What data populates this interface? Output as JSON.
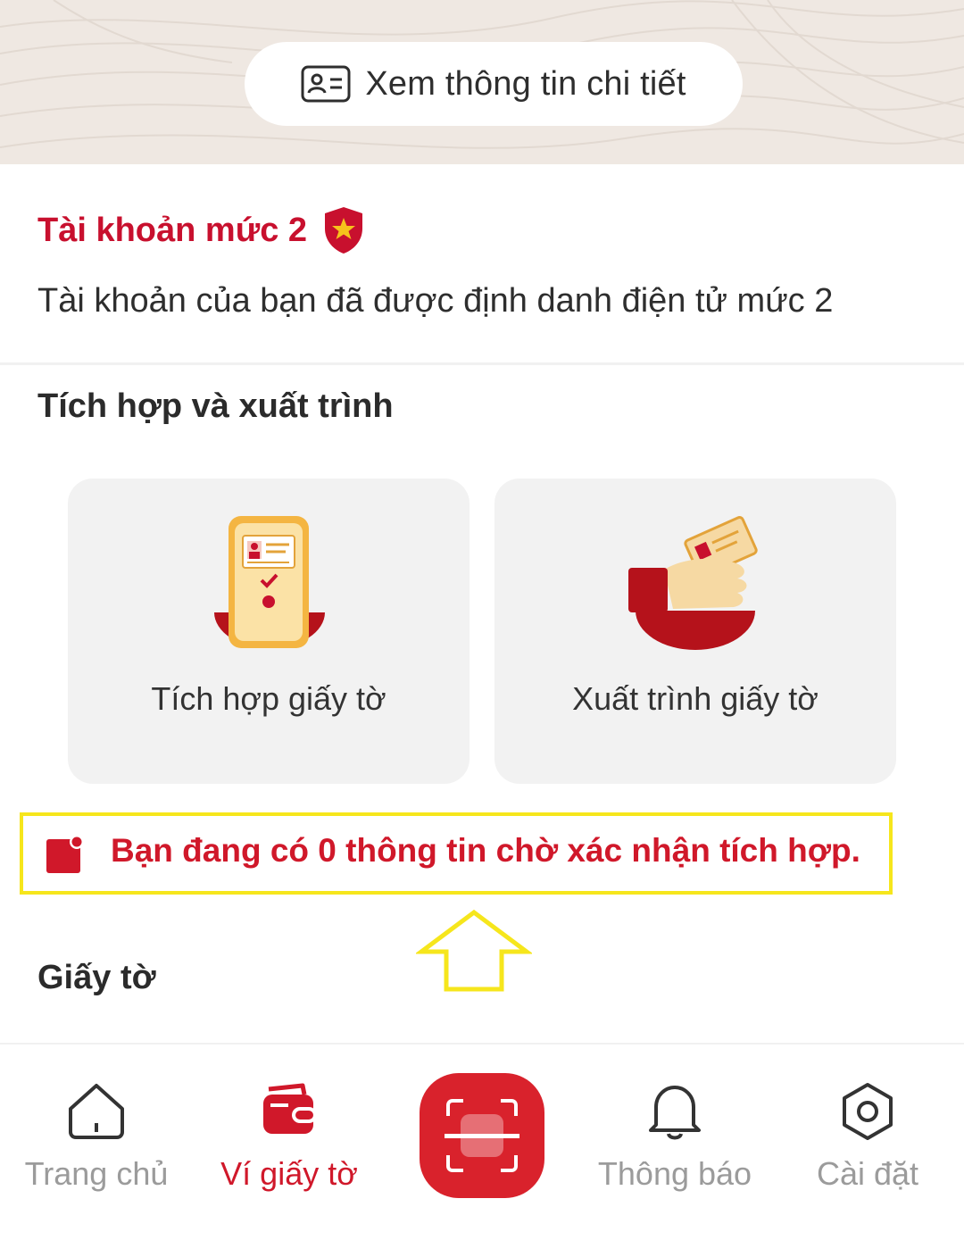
{
  "header": {
    "detail_button_label": "Xem thông tin chi tiết",
    "detail_icon": "id-card-icon"
  },
  "account": {
    "title": "Tài khoản mức 2",
    "badge_icon": "shield-star-icon",
    "description": "Tài khoản của bạn đã được định danh điện tử mức 2"
  },
  "integration": {
    "section_title": "Tích hợp và xuất trình",
    "cards": [
      {
        "label": "Tích hợp giấy tờ",
        "icon": "phone-document-icon"
      },
      {
        "label": "Xuất trình giấy tờ",
        "icon": "hand-card-icon"
      }
    ]
  },
  "notice": {
    "icon": "notification-square-icon",
    "text": "Bạn đang có 0 thông tin chờ xác nhận tích hợp."
  },
  "documents": {
    "section_title": "Giấy tờ"
  },
  "bottom_nav": {
    "items": [
      {
        "label": "Trang chủ",
        "icon": "home-icon",
        "active": false
      },
      {
        "label": "Ví giấy tờ",
        "icon": "wallet-icon",
        "active": true
      },
      {
        "label": "Thông báo",
        "icon": "bell-icon",
        "active": false
      },
      {
        "label": "Cài đặt",
        "icon": "settings-icon",
        "active": false
      }
    ],
    "scan_icon": "scan-icon"
  },
  "colors": {
    "brand_red": "#d0182a",
    "annotation_yellow": "#f6e61c",
    "inactive_gray": "#9b9b9b"
  }
}
